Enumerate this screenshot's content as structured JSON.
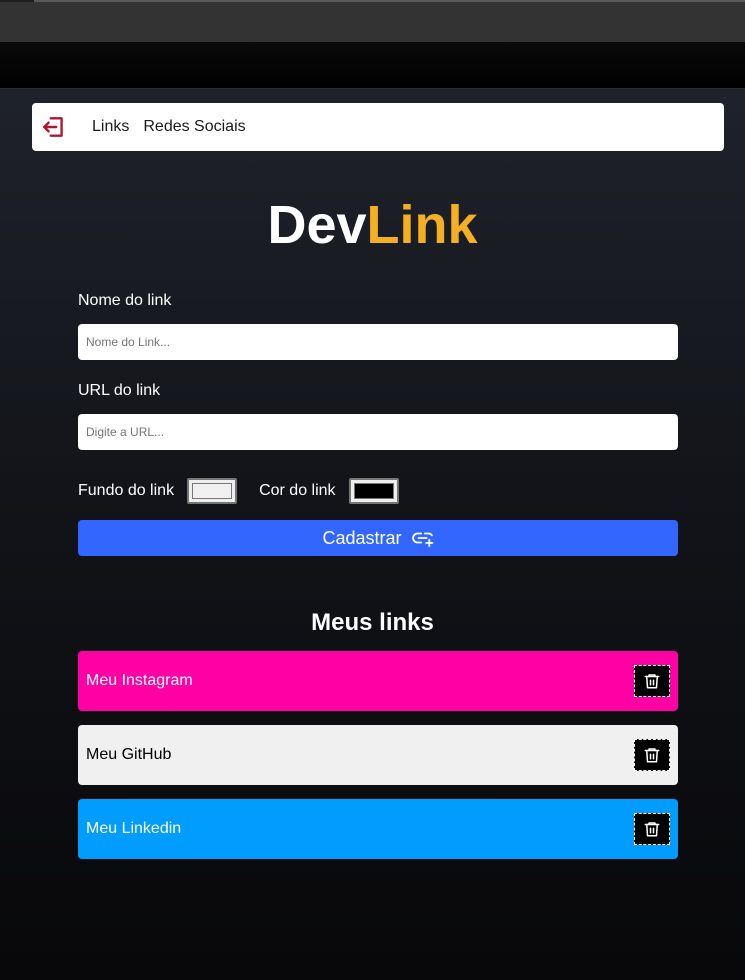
{
  "nav": {
    "logout_icon": "logout-icon",
    "items": [
      {
        "label": "Links"
      },
      {
        "label": "Redes Sociais"
      }
    ],
    "accent_color": "#b0182f"
  },
  "brand": {
    "part1": "Dev",
    "part2": "Link",
    "accent_color": "#f5b022"
  },
  "form": {
    "name_label": "Nome do link",
    "name_placeholder": "Nome do Link...",
    "url_label": "URL do link",
    "url_placeholder": "Digite a URL...",
    "bg_label": "Fundo do link",
    "bg_value": "#f1f1f1",
    "text_color_label": "Cor do link",
    "text_color_value": "#000000",
    "submit_label": "Cadastrar",
    "submit_icon": "link-plus-icon",
    "submit_color": "#3366ff"
  },
  "links": {
    "title": "Meus links",
    "items": [
      {
        "name": "Meu Instagram",
        "bg": "#ff00a4",
        "color": "#ffffff"
      },
      {
        "name": "Meu GitHub",
        "bg": "#f0f0f0",
        "color": "#000000"
      },
      {
        "name": "Meu Linkedin",
        "bg": "#009dff",
        "color": "#ffffff"
      }
    ],
    "delete_icon": "trash-icon"
  }
}
